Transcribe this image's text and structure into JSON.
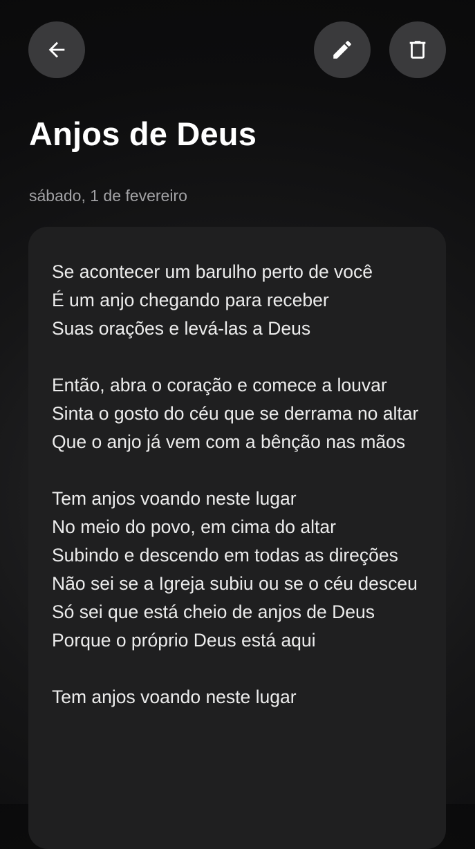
{
  "header": {
    "back_icon": "arrow-left-icon",
    "edit_icon": "pencil-icon",
    "delete_icon": "trash-icon"
  },
  "colors": {
    "background": "#0d0d0e",
    "button_bg": "#3a3a3c",
    "card_bg": "#1f1f20",
    "text": "#ececec",
    "date_text": "#a3a3a6"
  },
  "note": {
    "title": "Anjos de Deus",
    "date": "sábado, 1 de fevereiro",
    "stanzas": [
      [
        "Se acontecer um barulho perto de você",
        "É um anjo chegando para receber",
        "Suas orações e levá-las a Deus"
      ],
      [
        "Então, abra o coração e comece a louvar",
        "Sinta o gosto do céu que se derrama no altar",
        "Que o anjo já vem com a bênção nas mãos"
      ],
      [
        "Tem anjos voando neste lugar",
        "No meio do povo, em cima do altar",
        "Subindo e descendo em todas as direções",
        "Não sei se a Igreja subiu ou se o céu desceu",
        "Só sei que está cheio de anjos de Deus",
        "Porque o próprio Deus está aqui"
      ],
      [
        "Tem anjos voando neste lugar"
      ]
    ]
  }
}
